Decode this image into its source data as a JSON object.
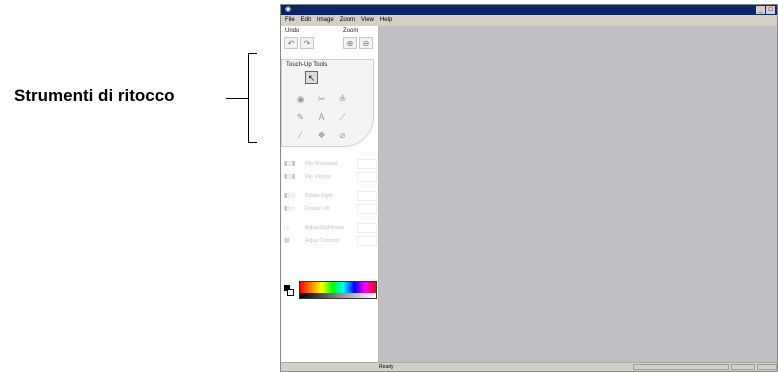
{
  "callout": {
    "label": "Strumenti di ritocco"
  },
  "window": {
    "menu": [
      "File",
      "Edit",
      "Image",
      "Zoom",
      "View",
      "Help"
    ],
    "undo_label": "Undo",
    "zoom_label": "Zoom",
    "touchup_label": "Touch-Up Tools",
    "operations": [
      {
        "label": "Flip Horizontal",
        "icon": "flip-horizontal-icon"
      },
      {
        "label": "Flip Vertical",
        "icon": "flip-vertical-icon"
      },
      {
        "label": "Rotate Right",
        "icon": "rotate-right-icon"
      },
      {
        "label": "Rotate Left",
        "icon": "rotate-left-icon"
      },
      {
        "label": "Adjust Brightness",
        "icon": "brightness-icon"
      },
      {
        "label": "Adjust Contrast",
        "icon": "contrast-icon"
      }
    ],
    "status": "Ready"
  },
  "colors": {
    "titlebar": "#0a246a",
    "canvas": "#c0bfc3"
  }
}
